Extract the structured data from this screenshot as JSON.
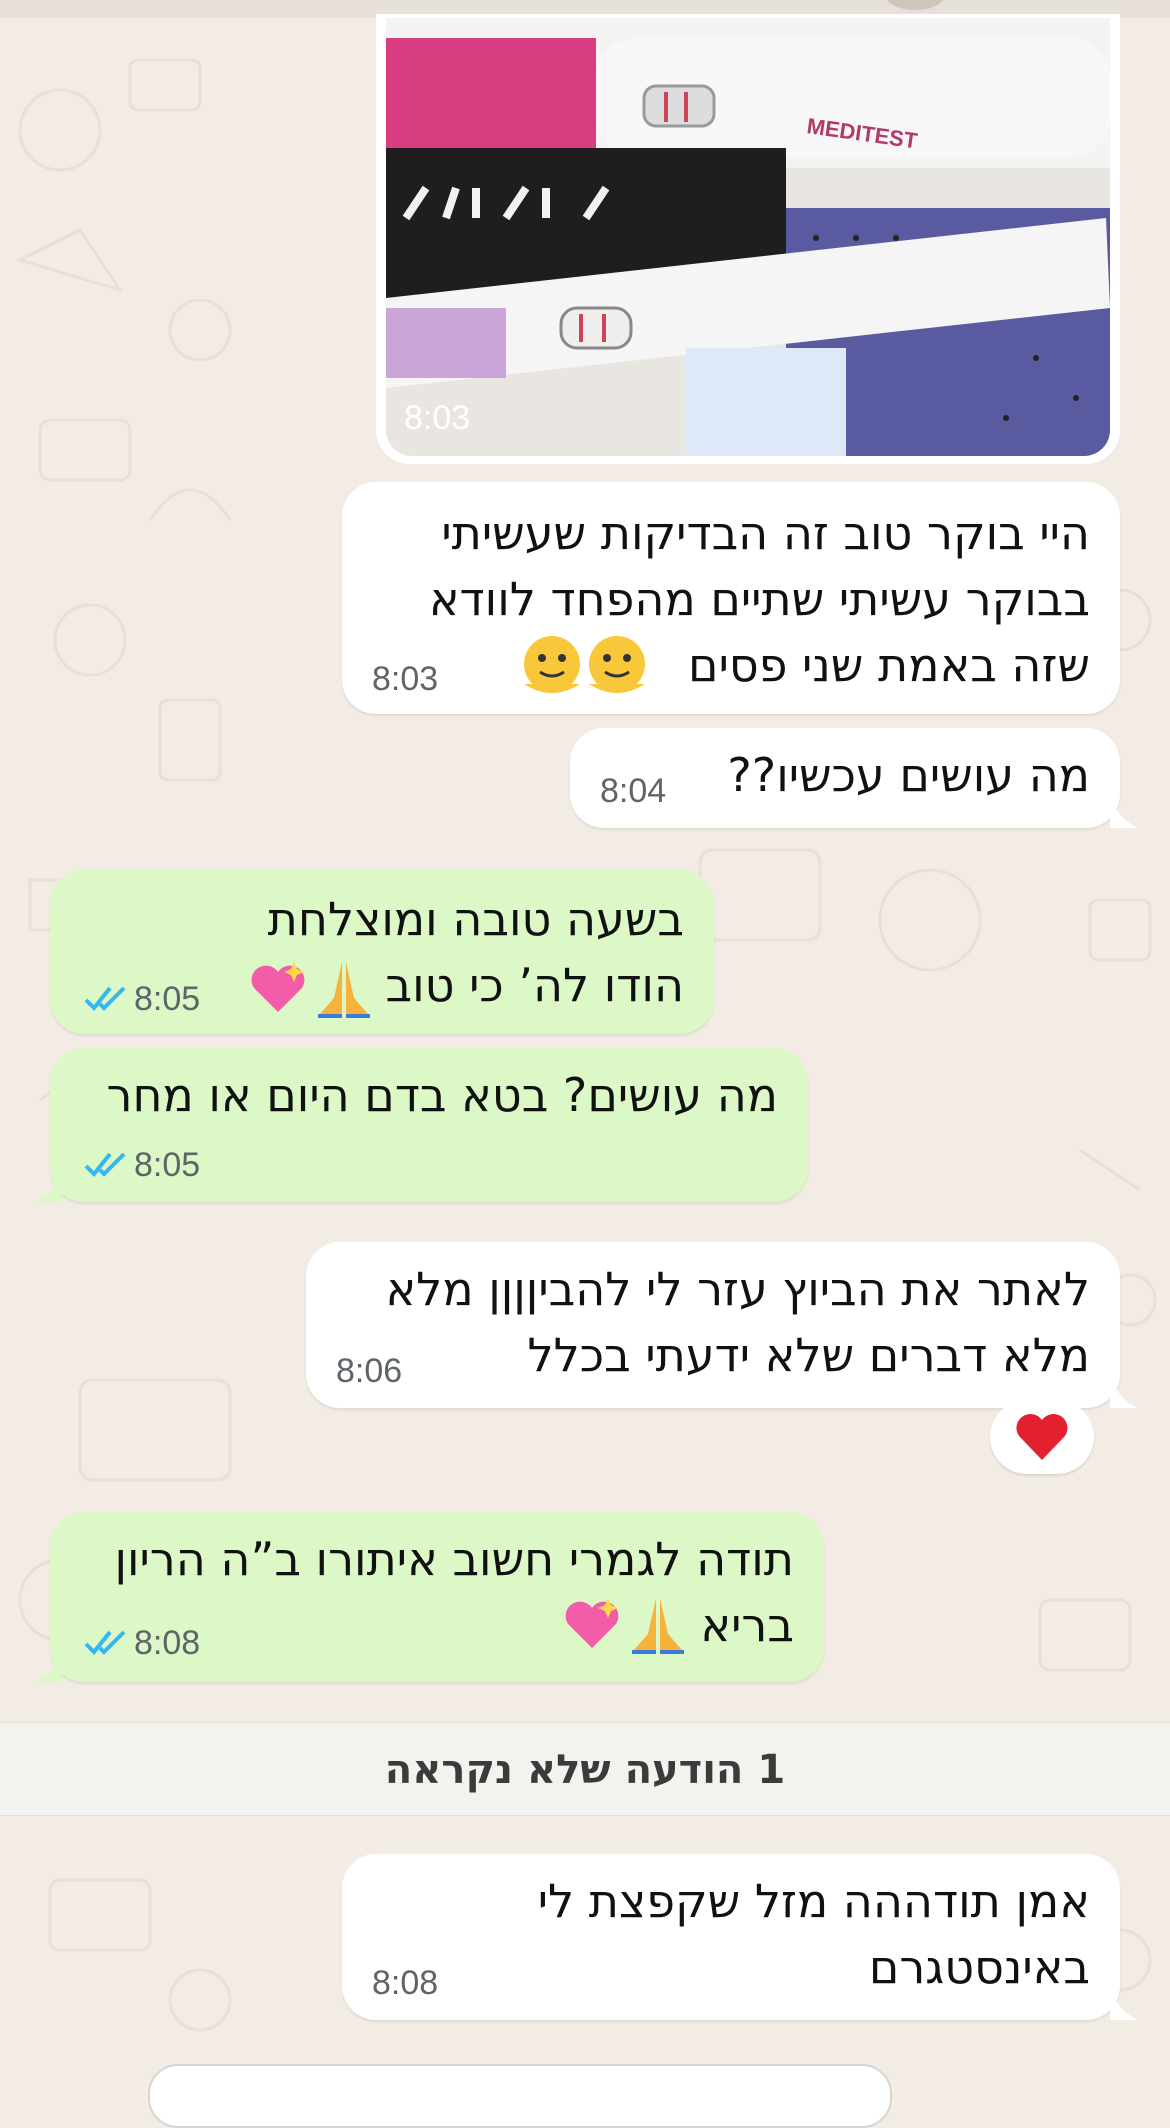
{
  "messages": [
    {
      "time": "8:03"
    },
    {
      "lines": [
        "היי בוקר טוב זה הבדיקות שעשיתי",
        "בבוקר עשיתי שתיים מהפחד לוודא",
        "שזה באמת שני פסים"
      ],
      "time": "8:03"
    },
    {
      "lines": [
        "מה עושים עכשיו??"
      ],
      "time": "8:04"
    },
    {
      "lines": [
        "בשעה טובה ומוצלחת",
        "הודו לה’ כי טוב"
      ],
      "time": "8:05"
    },
    {
      "lines": [
        "מה עושים? בטא בדם היום או מחר"
      ],
      "time": "8:05"
    },
    {
      "lines": [
        "לאתר את הביוץ עזר לי להביןןןן מלא",
        "מלא דברים שלא ידעתי בכלל"
      ],
      "time": "8:06"
    },
    {
      "lines": [
        "תודה לגמרי חשוב איתורו ב”ה הריון",
        "בריא"
      ],
      "time": "8:08"
    },
    {
      "lines": [
        "אמן  תודההה מזל שקפצת לי",
        "באינסטגרם"
      ],
      "time": "8:08"
    }
  ],
  "photo": {
    "brand_text": "MEDITEST"
  },
  "unread_divider": "1 הודעה שלא נקראה",
  "colors": {
    "incoming": "#ffffff",
    "outgoing": "#dcf8c6",
    "read_ticks": "#34b7f1",
    "wallpaper": "#f2ece4"
  },
  "icons": [
    "read-ticks-icon",
    "heart-icon",
    "praying-hands-icon",
    "sparkling-heart-icon",
    "melting-face-icon"
  ]
}
